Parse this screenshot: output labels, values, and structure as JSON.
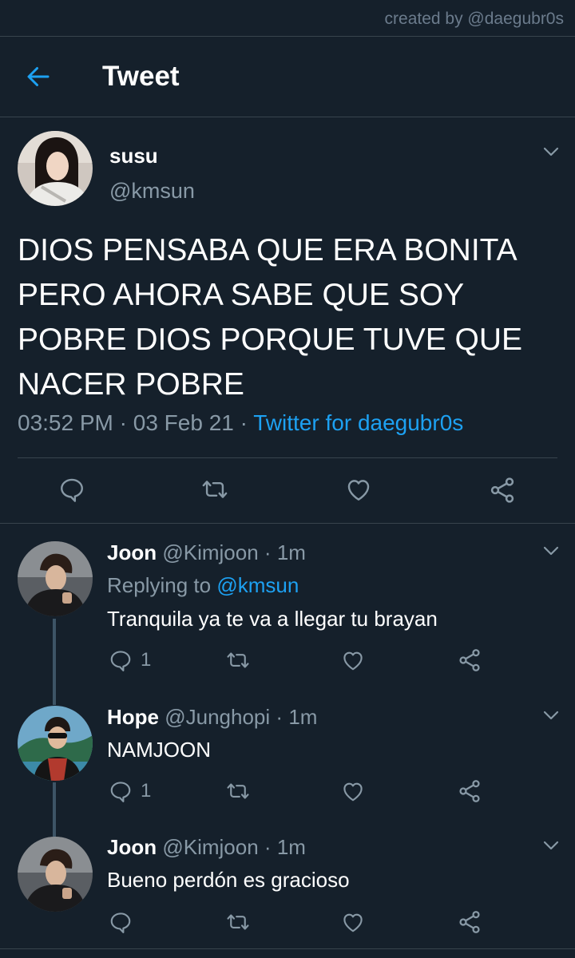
{
  "credit": "created by @daegubr0s",
  "header": {
    "title": "Tweet"
  },
  "main_tweet": {
    "name": "susu",
    "handle": "@kmsun",
    "text": "DIOS PENSABA QUE ERA BONITA PERO AHORA SABE QUE SOY POBRE DIOS PORQUE TUVE QUE NACER POBRE",
    "time": "03:52 PM",
    "date": "03 Feb 21",
    "dot": "·",
    "source": "Twitter for daegubr0s"
  },
  "replies": [
    {
      "name": "Joon",
      "handle": "@Kimjoon",
      "time": "1m",
      "dot": "·",
      "replying_label": "Replying to",
      "replying_to": "@kmsun",
      "text": "Tranquila ya te va a llegar tu brayan",
      "reply_count": "1"
    },
    {
      "name": "Hope",
      "handle": "@Junghopi",
      "time": "1m",
      "dot": "·",
      "text": "NAMJOON",
      "reply_count": "1"
    },
    {
      "name": "Joon",
      "handle": "@Kimjoon",
      "time": "1m",
      "dot": "·",
      "text": "Bueno perdón es gracioso",
      "reply_count": ""
    }
  ],
  "colors": {
    "background": "#15202b",
    "accent": "#1da1f2",
    "secondary_text": "#8899a6",
    "divider": "#38444d"
  },
  "icons": [
    "back-arrow-icon",
    "chevron-down-icon",
    "reply-icon",
    "retweet-icon",
    "like-icon",
    "share-icon"
  ]
}
